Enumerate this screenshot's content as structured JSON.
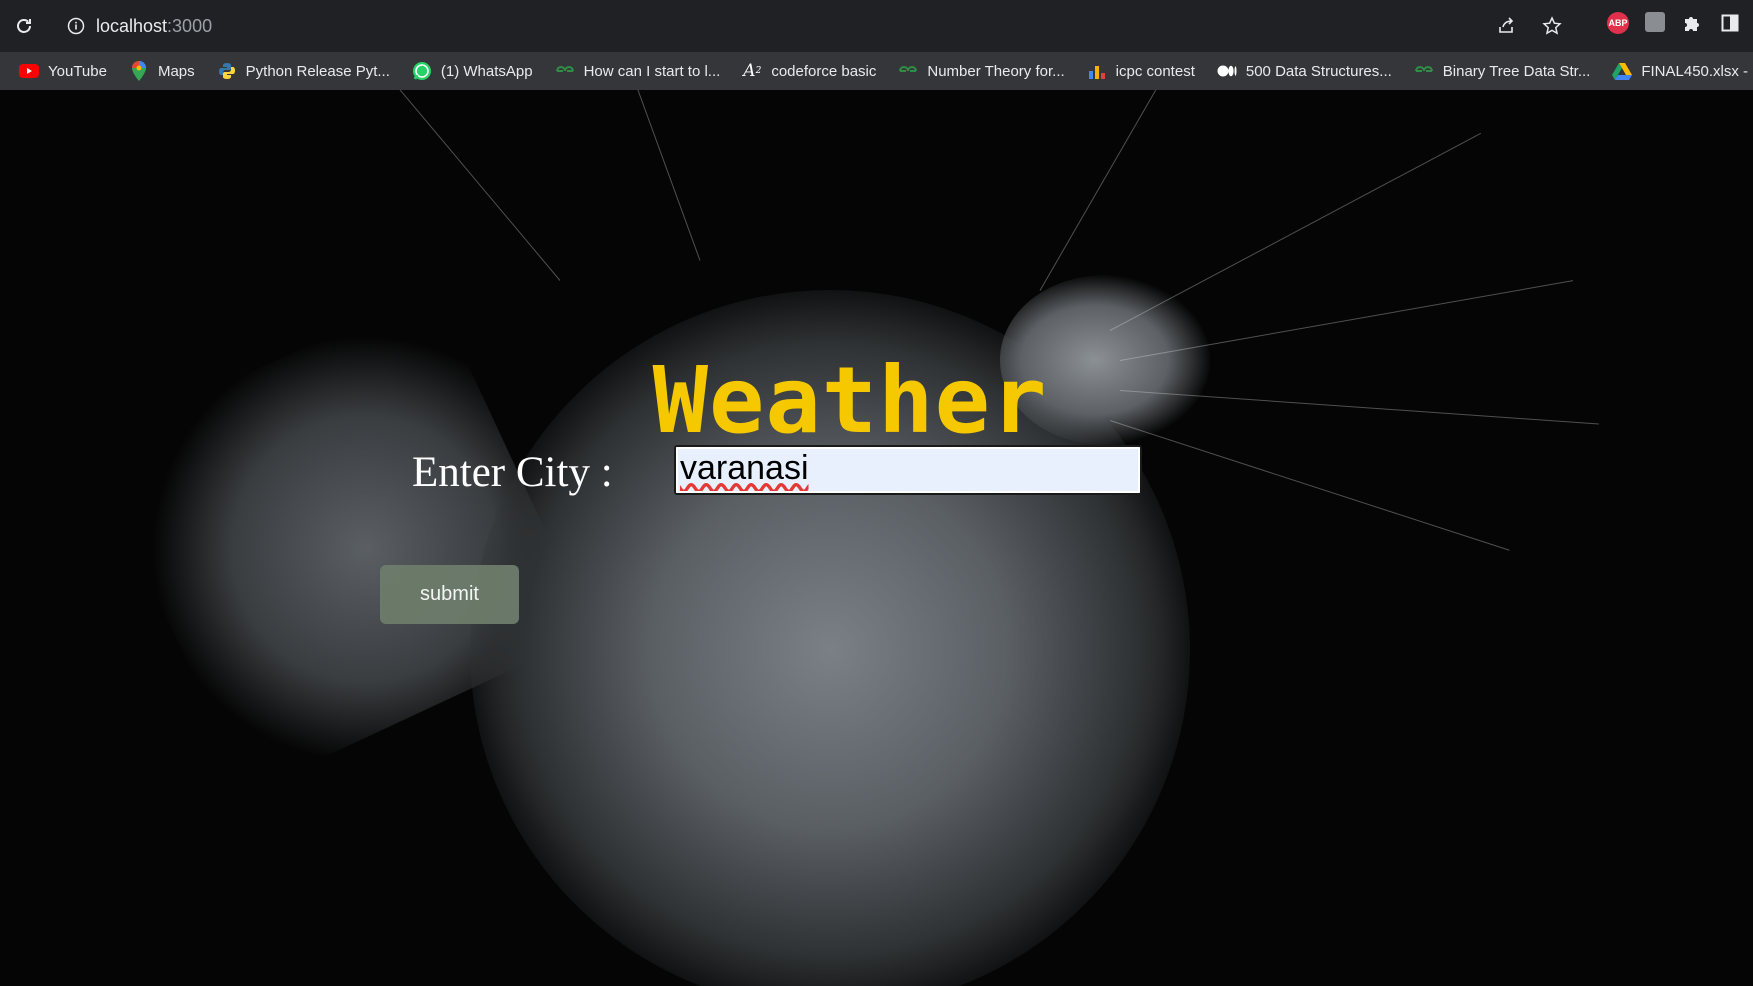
{
  "browser": {
    "url_host": "localhost",
    "url_port": ":3000",
    "bookmarks": [
      {
        "label": "YouTube",
        "icon": "youtube-icon",
        "color": "#ff0000"
      },
      {
        "label": "Maps",
        "icon": "maps-pin-icon",
        "color": "#34a853"
      },
      {
        "label": "Python Release Pyt...",
        "icon": "python-icon",
        "color": "#3776ab"
      },
      {
        "label": "(1) WhatsApp",
        "icon": "whatsapp-icon",
        "color": "#25d366"
      },
      {
        "label": "How can I start to l...",
        "icon": "geeksforgeeks-icon",
        "color": "#2f8d46"
      },
      {
        "label": "codeforce basic",
        "icon": "a-squared-icon",
        "color": "#ffffff"
      },
      {
        "label": "Number Theory for...",
        "icon": "geeksforgeeks-icon",
        "color": "#2f8d46"
      },
      {
        "label": "icpc contest",
        "icon": "bar-chart-icon",
        "color": "#f4b400"
      },
      {
        "label": "500 Data Structures...",
        "icon": "medium-icon",
        "color": "#ffffff"
      },
      {
        "label": "Binary Tree Data Str...",
        "icon": "geeksforgeeks-icon",
        "color": "#2f8d46"
      },
      {
        "label": "FINAL450.xlsx - Go...",
        "icon": "google-drive-icon",
        "color": "#1fa463"
      }
    ]
  },
  "app": {
    "title": "Weather",
    "city_label": "Enter City :",
    "city_value": "varanasi",
    "submit_label": "submit",
    "title_color": "#f6c800"
  }
}
